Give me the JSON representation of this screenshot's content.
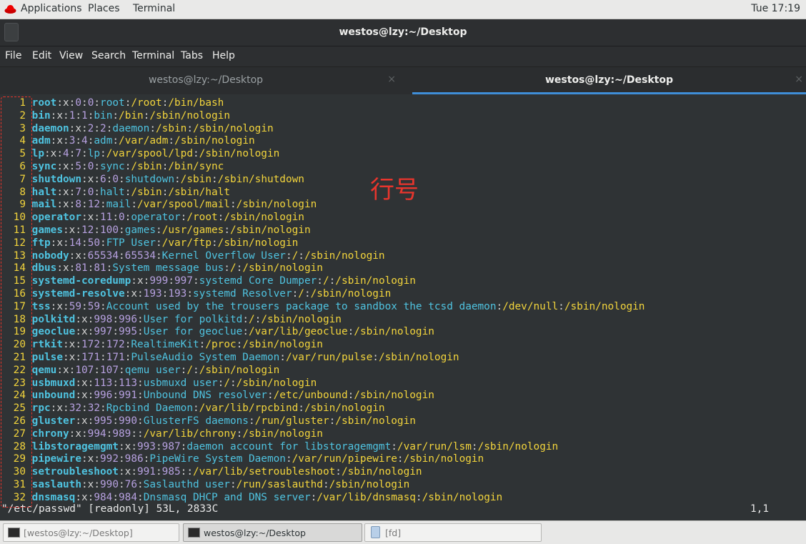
{
  "topbar": {
    "applications_label": "Applications",
    "places_label": "Places",
    "terminal_label": "Terminal",
    "clock": "Tue 17:19"
  },
  "window": {
    "title": "westos@lzy:~/Desktop"
  },
  "menubar": {
    "items": [
      "File",
      "Edit",
      "View",
      "Search",
      "Terminal",
      "Tabs",
      "Help"
    ]
  },
  "tabs": [
    {
      "label": "westos@lzy:~/Desktop",
      "active": false,
      "close": "×"
    },
    {
      "label": "westos@lzy:~/Desktop",
      "active": true,
      "close": "×"
    }
  ],
  "terminal": {
    "lines": [
      {
        "n": "1",
        "user": "root",
        "uid": "0",
        "gid": "0",
        "gecos": "root",
        "home": "/root",
        "shell": "/bin/bash"
      },
      {
        "n": "2",
        "user": "bin",
        "uid": "1",
        "gid": "1",
        "gecos": "bin",
        "home": "/bin",
        "shell": "/sbin/nologin"
      },
      {
        "n": "3",
        "user": "daemon",
        "uid": "2",
        "gid": "2",
        "gecos": "daemon",
        "home": "/sbin",
        "shell": "/sbin/nologin"
      },
      {
        "n": "4",
        "user": "adm",
        "uid": "3",
        "gid": "4",
        "gecos": "adm",
        "home": "/var/adm",
        "shell": "/sbin/nologin"
      },
      {
        "n": "5",
        "user": "lp",
        "uid": "4",
        "gid": "7",
        "gecos": "lp",
        "home": "/var/spool/lpd",
        "shell": "/sbin/nologin"
      },
      {
        "n": "6",
        "user": "sync",
        "uid": "5",
        "gid": "0",
        "gecos": "sync",
        "home": "/sbin",
        "shell": "/bin/sync"
      },
      {
        "n": "7",
        "user": "shutdown",
        "uid": "6",
        "gid": "0",
        "gecos": "shutdown",
        "home": "/sbin",
        "shell": "/sbin/shutdown"
      },
      {
        "n": "8",
        "user": "halt",
        "uid": "7",
        "gid": "0",
        "gecos": "halt",
        "home": "/sbin",
        "shell": "/sbin/halt"
      },
      {
        "n": "9",
        "user": "mail",
        "uid": "8",
        "gid": "12",
        "gecos": "mail",
        "home": "/var/spool/mail",
        "shell": "/sbin/nologin"
      },
      {
        "n": "10",
        "user": "operator",
        "uid": "11",
        "gid": "0",
        "gecos": "operator",
        "home": "/root",
        "shell": "/sbin/nologin"
      },
      {
        "n": "11",
        "user": "games",
        "uid": "12",
        "gid": "100",
        "gecos": "games",
        "home": "/usr/games",
        "shell": "/sbin/nologin"
      },
      {
        "n": "12",
        "user": "ftp",
        "uid": "14",
        "gid": "50",
        "gecos": "FTP User",
        "home": "/var/ftp",
        "shell": "/sbin/nologin"
      },
      {
        "n": "13",
        "user": "nobody",
        "uid": "65534",
        "gid": "65534",
        "gecos": "Kernel Overflow User",
        "home": "/",
        "shell": "/sbin/nologin"
      },
      {
        "n": "14",
        "user": "dbus",
        "uid": "81",
        "gid": "81",
        "gecos": "System message bus",
        "home": "/",
        "shell": "/sbin/nologin"
      },
      {
        "n": "15",
        "user": "systemd-coredump",
        "uid": "999",
        "gid": "997",
        "gecos": "systemd Core Dumper",
        "home": "/",
        "shell": "/sbin/nologin"
      },
      {
        "n": "16",
        "user": "systemd-resolve",
        "uid": "193",
        "gid": "193",
        "gecos": "systemd Resolver",
        "home": "/",
        "shell": "/sbin/nologin"
      },
      {
        "n": "17",
        "user": "tss",
        "uid": "59",
        "gid": "59",
        "gecos": "Account used by the trousers package to sandbox the tcsd daemon",
        "home": "/dev/null",
        "shell": "/sbin/nologin"
      },
      {
        "n": "18",
        "user": "polkitd",
        "uid": "998",
        "gid": "996",
        "gecos": "User for polkitd",
        "home": "/",
        "shell": "/sbin/nologin"
      },
      {
        "n": "19",
        "user": "geoclue",
        "uid": "997",
        "gid": "995",
        "gecos": "User for geoclue",
        "home": "/var/lib/geoclue",
        "shell": "/sbin/nologin"
      },
      {
        "n": "20",
        "user": "rtkit",
        "uid": "172",
        "gid": "172",
        "gecos": "RealtimeKit",
        "home": "/proc",
        "shell": "/sbin/nologin"
      },
      {
        "n": "21",
        "user": "pulse",
        "uid": "171",
        "gid": "171",
        "gecos": "PulseAudio System Daemon",
        "home": "/var/run/pulse",
        "shell": "/sbin/nologin"
      },
      {
        "n": "22",
        "user": "qemu",
        "uid": "107",
        "gid": "107",
        "gecos": "qemu user",
        "home": "/",
        "shell": "/sbin/nologin"
      },
      {
        "n": "23",
        "user": "usbmuxd",
        "uid": "113",
        "gid": "113",
        "gecos": "usbmuxd user",
        "home": "/",
        "shell": "/sbin/nologin"
      },
      {
        "n": "24",
        "user": "unbound",
        "uid": "996",
        "gid": "991",
        "gecos": "Unbound DNS resolver",
        "home": "/etc/unbound",
        "shell": "/sbin/nologin"
      },
      {
        "n": "25",
        "user": "rpc",
        "uid": "32",
        "gid": "32",
        "gecos": "Rpcbind Daemon",
        "home": "/var/lib/rpcbind",
        "shell": "/sbin/nologin"
      },
      {
        "n": "26",
        "user": "gluster",
        "uid": "995",
        "gid": "990",
        "gecos": "GlusterFS daemons",
        "home": "/run/gluster",
        "shell": "/sbin/nologin"
      },
      {
        "n": "27",
        "user": "chrony",
        "uid": "994",
        "gid": "989",
        "gecos": "",
        "home": "/var/lib/chrony",
        "shell": "/sbin/nologin"
      },
      {
        "n": "28",
        "user": "libstoragemgmt",
        "uid": "993",
        "gid": "987",
        "gecos": "daemon account for libstoragemgmt",
        "home": "/var/run/lsm",
        "shell": "/sbin/nologin"
      },
      {
        "n": "29",
        "user": "pipewire",
        "uid": "992",
        "gid": "986",
        "gecos": "PipeWire System Daemon",
        "home": "/var/run/pipewire",
        "shell": "/sbin/nologin"
      },
      {
        "n": "30",
        "user": "setroubleshoot",
        "uid": "991",
        "gid": "985",
        "gecos": "",
        "home": "/var/lib/setroubleshoot",
        "shell": "/sbin/nologin"
      },
      {
        "n": "31",
        "user": "saslauth",
        "uid": "990",
        "gid": "76",
        "gecos": "Saslauthd user",
        "home": "/run/saslauthd",
        "shell": "/sbin/nologin"
      },
      {
        "n": "32",
        "user": "dnsmasq",
        "uid": "984",
        "gid": "984",
        "gecos": "Dnsmasq DHCP and DNS server",
        "home": "/var/lib/dnsmasq",
        "shell": "/sbin/nologin"
      }
    ],
    "status_left": "\"/etc/passwd\" [readonly] 53L, 2833C",
    "status_right": "1,1"
  },
  "annotation": {
    "label": "行号",
    "color": "#e6322a"
  },
  "taskbar": {
    "items": [
      {
        "label": "[westos@lzy:~/Desktop]"
      },
      {
        "label": "westos@lzy:~/Desktop"
      },
      {
        "label": "[fd]"
      }
    ]
  },
  "colors": {
    "line_number": "#f2d43c",
    "username": "#4fc3e0",
    "id_numbers": "#b7a1e0",
    "path": "#f2d43c",
    "terminal_bg": "#2f3335",
    "active_tab_underline": "#3f8ed8"
  }
}
